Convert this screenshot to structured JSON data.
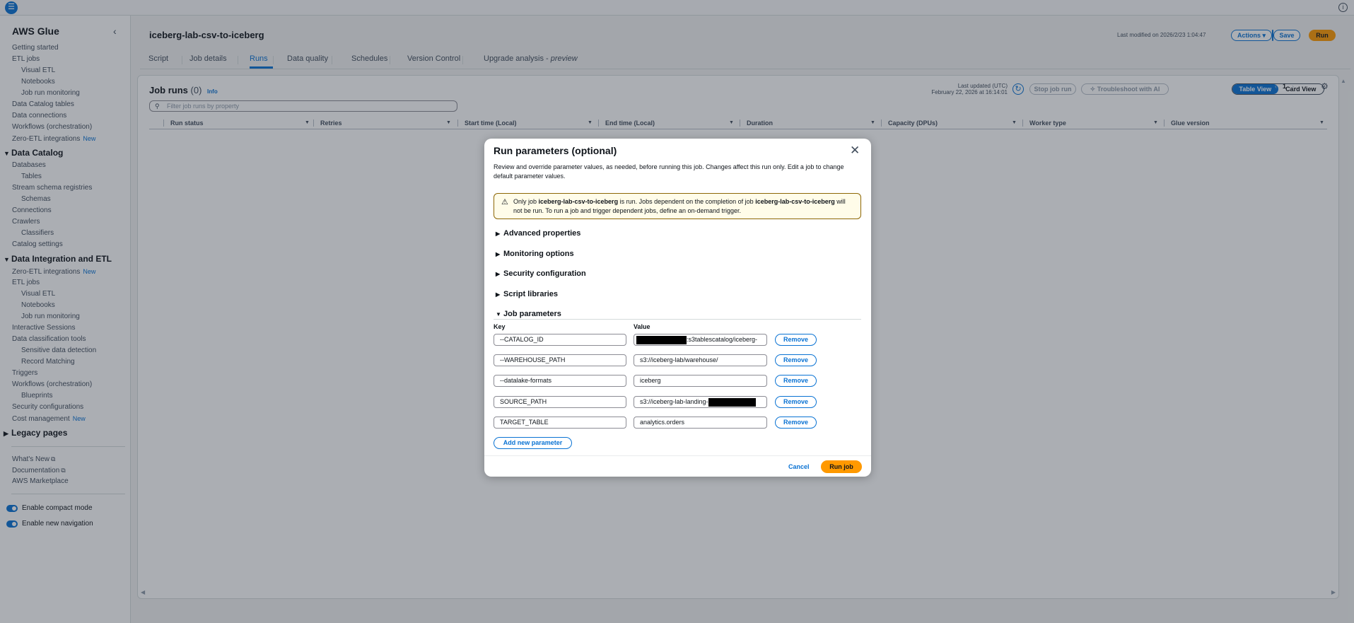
{
  "topbar": {
    "menu_icon": "hamburger-icon",
    "info_icon": "info-icon"
  },
  "sidebar": {
    "title": "AWS Glue",
    "collapse_icon": "chevron-left-icon",
    "items": [
      {
        "kind": "l1",
        "label": "Getting started"
      },
      {
        "kind": "l1",
        "label": "ETL jobs"
      },
      {
        "kind": "l2",
        "label": "Visual ETL"
      },
      {
        "kind": "l2",
        "label": "Notebooks"
      },
      {
        "kind": "l2",
        "label": "Job run monitoring"
      },
      {
        "kind": "l1",
        "label": "Data Catalog tables"
      },
      {
        "kind": "l1",
        "label": "Data connections"
      },
      {
        "kind": "l1",
        "label": "Workflows (orchestration)"
      },
      {
        "kind": "l1",
        "label": "Zero-ETL integrations",
        "badge": "New"
      },
      {
        "kind": "section",
        "label": "Data Catalog"
      },
      {
        "kind": "l1",
        "label": "Databases"
      },
      {
        "kind": "l2",
        "label": "Tables"
      },
      {
        "kind": "l1",
        "label": "Stream schema registries"
      },
      {
        "kind": "l2",
        "label": "Schemas"
      },
      {
        "kind": "l1",
        "label": "Connections"
      },
      {
        "kind": "l1",
        "label": "Crawlers"
      },
      {
        "kind": "l2",
        "label": "Classifiers"
      },
      {
        "kind": "l1",
        "label": "Catalog settings"
      },
      {
        "kind": "section",
        "label": "Data Integration and ETL"
      },
      {
        "kind": "l1",
        "label": "Zero-ETL integrations",
        "badge": "New"
      },
      {
        "kind": "l1",
        "label": "ETL jobs"
      },
      {
        "kind": "l2",
        "label": "Visual ETL"
      },
      {
        "kind": "l2",
        "label": "Notebooks"
      },
      {
        "kind": "l2",
        "label": "Job run monitoring"
      },
      {
        "kind": "l1",
        "label": "Interactive Sessions"
      },
      {
        "kind": "l1",
        "label": "Data classification tools"
      },
      {
        "kind": "l2",
        "label": "Sensitive data detection"
      },
      {
        "kind": "l2",
        "label": "Record Matching"
      },
      {
        "kind": "l1",
        "label": "Triggers"
      },
      {
        "kind": "l1",
        "label": "Workflows (orchestration)"
      },
      {
        "kind": "l2",
        "label": "Blueprints"
      },
      {
        "kind": "l1",
        "label": "Security configurations"
      },
      {
        "kind": "l1",
        "label": "Cost management",
        "badge": "New"
      },
      {
        "kind": "section-collapsed",
        "label": "Legacy pages"
      }
    ],
    "footer_links": [
      {
        "label": "What's New",
        "icon": "external-link-icon"
      },
      {
        "label": "Documentation",
        "icon": "external-link-icon"
      },
      {
        "label": "AWS Marketplace"
      }
    ],
    "toggles": [
      {
        "label": "Enable compact mode"
      },
      {
        "label": "Enable new navigation"
      }
    ]
  },
  "header": {
    "title": "iceberg-lab-csv-to-iceberg",
    "last_modified": "Last modified on 2026/2/23 1:04:47",
    "actions_label": "Actions",
    "save_label": "Save",
    "run_label": "Run"
  },
  "tabs": [
    {
      "label": "Script"
    },
    {
      "label": "Job details"
    },
    {
      "label": "Runs"
    },
    {
      "label": "Data quality"
    },
    {
      "label": "Schedules"
    },
    {
      "label": "Version Control"
    },
    {
      "label": "Upgrade analysis - ",
      "suffix": "preview"
    }
  ],
  "runs": {
    "title": "Job runs",
    "count": "(0)",
    "info": "Info",
    "last_updated_line1": "Last updated (UTC)",
    "last_updated_line2": "February 22, 2026 at 16:14:01",
    "stop_label": "Stop job run",
    "troubleshoot_label": "Troubleshoot with AI",
    "table_view": "Table View",
    "card_view": "Card View",
    "search_placeholder": "Filter job runs by property",
    "page": "1",
    "columns": [
      "Run status",
      "Retries",
      "Start time (Local)",
      "End time (Local)",
      "Duration",
      "Capacity (DPUs)",
      "Worker type",
      "Glue version"
    ]
  },
  "modal": {
    "title": "Run parameters (optional)",
    "description": "Review and override parameter values, as needed, before running this job. Changes affect this run only. Edit a job to change default parameter values.",
    "alert_prefix": "Only job ",
    "alert_job": "iceberg-lab-csv-to-iceberg",
    "alert_mid": " is run. Jobs dependent on the completion of job ",
    "alert_job2": "iceberg-lab-csv-to-iceberg",
    "alert_suffix": " will not be run. To run a job and trigger dependent jobs, define an on-demand trigger.",
    "sections": [
      "Advanced properties",
      "Monitoring options",
      "Security configuration",
      "Script libraries",
      "Job parameters"
    ],
    "key_label": "Key",
    "value_label": "Value",
    "params": [
      {
        "key": "--CATALOG_ID",
        "value": ":s3tablescatalog/iceberg-"
      },
      {
        "key": "--WAREHOUSE_PATH",
        "value": "s3://iceberg-lab/warehouse/"
      },
      {
        "key": "--datalake-formats",
        "value": "iceberg"
      },
      {
        "key": "SOURCE_PATH",
        "value": "s3://iceberg-lab-landing-"
      },
      {
        "key": "TARGET_TABLE",
        "value": "analytics.orders"
      }
    ],
    "remove_label": "Remove",
    "add_label": "Add new parameter",
    "cancel_label": "Cancel",
    "run_label": "Run job"
  }
}
